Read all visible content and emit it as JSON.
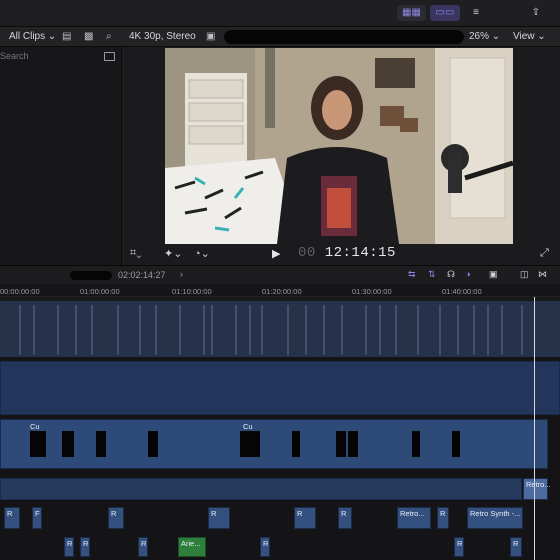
{
  "toolbar": {
    "view_buttons": [
      "clip-appearance-icon",
      "filmstrip-icon",
      "inspector-icon"
    ],
    "share_icon": "share-icon"
  },
  "browser": {
    "library_label": "All Clips",
    "search_placeholder": "Search"
  },
  "viewer": {
    "format_label": "4K 30p, Stereo",
    "zoom_label": "26%",
    "view_label": "View",
    "timecode": "12:14:15",
    "timecode_dim": "00"
  },
  "timeline": {
    "position_timecode": "02:02:14:27",
    "ruler_labels": [
      "00:00:00:00",
      "01:00:00:00",
      "01:10:00:00",
      "01:20:00:00",
      "01:30:00:00",
      "01:40:00:00"
    ],
    "clips": {
      "cu_label": "Cu",
      "retro_short": "Retro...",
      "retro_synth": "Retro Synth -...",
      "retro_right": "Retro...",
      "green_label": "Arie...",
      "r": "R",
      "f": "F"
    }
  },
  "colors": {
    "accent": "#8e86e8",
    "clip_blue": "#33507f",
    "clip_green": "#2f7f3c"
  }
}
